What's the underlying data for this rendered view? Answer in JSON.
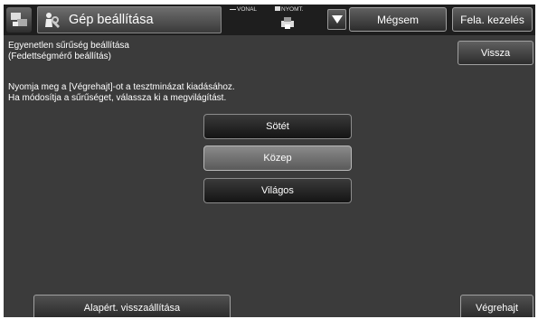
{
  "header": {
    "title": "Gép beállítása",
    "status_line": "VONAL",
    "status_print": "NYOMT.",
    "cancel_label": "Mégsem",
    "job_status_label": "Fela. kezelés"
  },
  "panel": {
    "heading_line1": "Egyenetlen sűrűség beállítása",
    "heading_line2": "(Fedettségmérő beállítás)",
    "back_label": "Vissza",
    "instruction_line1": "Nyomja meg a [Végrehajt]-ot a tesztminázat kiadásához.",
    "instruction_line2": "Ha módosítja a sűrűséget, válassza ki a megvilágítást."
  },
  "density_options": [
    {
      "label": "Sötét",
      "selected": false
    },
    {
      "label": "Közep",
      "selected": true
    },
    {
      "label": "Világos",
      "selected": false
    }
  ],
  "footer": {
    "reset_label": "Alapért. visszaállítása",
    "execute_label": "Végrehajt"
  },
  "colors": {
    "background": "#3b3b3b",
    "topbar": "#1e1e1e",
    "text": "#ffffff"
  },
  "icons": {
    "home": "home-icon",
    "wrench": "wrench-icon",
    "printer": "printer-icon",
    "dropdown": "triangle-down-icon"
  }
}
